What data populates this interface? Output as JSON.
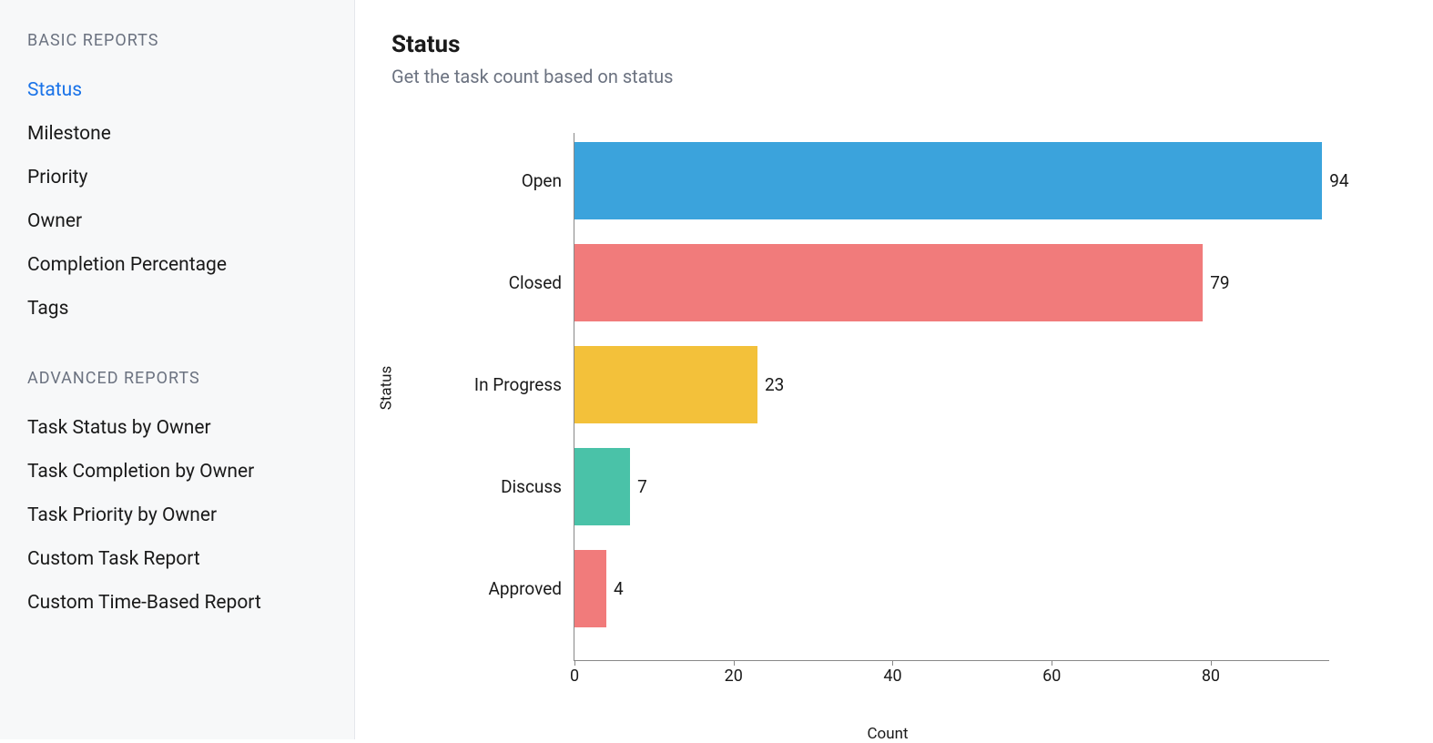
{
  "sidebar": {
    "section1_header": "BASIC REPORTS",
    "section1_items": [
      {
        "label": "Status",
        "active": true
      },
      {
        "label": "Milestone",
        "active": false
      },
      {
        "label": "Priority",
        "active": false
      },
      {
        "label": "Owner",
        "active": false
      },
      {
        "label": "Completion Percentage",
        "active": false
      },
      {
        "label": "Tags",
        "active": false
      }
    ],
    "section2_header": "ADVANCED REPORTS",
    "section2_items": [
      {
        "label": "Task Status by Owner",
        "active": false
      },
      {
        "label": "Task Completion by Owner",
        "active": false
      },
      {
        "label": "Task Priority by Owner",
        "active": false
      },
      {
        "label": "Custom Task Report",
        "active": false
      },
      {
        "label": "Custom Time-Based Report",
        "active": false
      }
    ]
  },
  "main": {
    "title": "Status",
    "subtitle": "Get the task count based on status"
  },
  "chart_data": {
    "type": "bar",
    "orientation": "horizontal",
    "categories": [
      "Open",
      "Closed",
      "In Progress",
      "Discuss",
      "Approved"
    ],
    "values": [
      94,
      79,
      23,
      7,
      4
    ],
    "colors": [
      "#3ba3dc",
      "#f17b7b",
      "#f3c13a",
      "#4ac2a8",
      "#f17b7b"
    ],
    "title": "Status",
    "xlabel": "Count",
    "ylabel": "Status",
    "x_ticks": [
      0,
      20,
      40,
      60,
      80
    ],
    "xlim": [
      0,
      95
    ]
  }
}
